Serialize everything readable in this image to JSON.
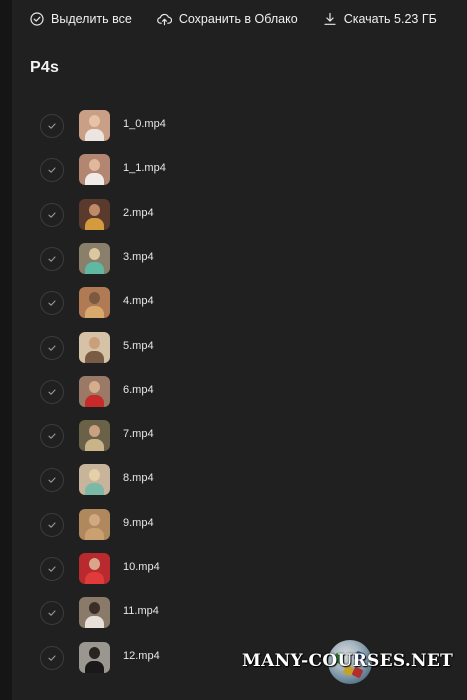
{
  "toolbar": {
    "select_all_label": "Выделить все",
    "save_cloud_label": "Сохранить в Облако",
    "download_label": "Скачать 5.23 ГБ"
  },
  "folder": {
    "title": "P4s"
  },
  "files": [
    {
      "name": "1_0.mp4",
      "thumb_bg": "#c9a086",
      "thumb_head": "#e6c2a6",
      "thumb_body": "#ece4df"
    },
    {
      "name": "1_1.mp4",
      "thumb_bg": "#b28670",
      "thumb_head": "#e1b89c",
      "thumb_body": "#f0ebe8"
    },
    {
      "name": "2.mp4",
      "thumb_bg": "#5a3a2c",
      "thumb_head": "#c08a68",
      "thumb_body": "#d39a3e"
    },
    {
      "name": "3.mp4",
      "thumb_bg": "#8a7f6a",
      "thumb_head": "#dcc7a0",
      "thumb_body": "#5fb8a2"
    },
    {
      "name": "4.mp4",
      "thumb_bg": "#b07a54",
      "thumb_head": "#7a5a40",
      "thumb_body": "#d9a86c"
    },
    {
      "name": "5.mp4",
      "thumb_bg": "#d6c2a6",
      "thumb_head": "#caa07a",
      "thumb_body": "#7a5c44"
    },
    {
      "name": "6.mp4",
      "thumb_bg": "#9a7a66",
      "thumb_head": "#d6ad8c",
      "thumb_body": "#c82a2a"
    },
    {
      "name": "7.mp4",
      "thumb_bg": "#6a6248",
      "thumb_head": "#c9a080",
      "thumb_body": "#c9b48a"
    },
    {
      "name": "8.mp4",
      "thumb_bg": "#c8b49a",
      "thumb_head": "#e6d0a8",
      "thumb_body": "#7ab8a8"
    },
    {
      "name": "9.mp4",
      "thumb_bg": "#b0885e",
      "thumb_head": "#d2a882",
      "thumb_body": "#caa070"
    },
    {
      "name": "10.mp4",
      "thumb_bg": "#b82a2e",
      "thumb_head": "#d8a68a",
      "thumb_body": "#e03a3a"
    },
    {
      "name": "11.mp4",
      "thumb_bg": "#8a7a6a",
      "thumb_head": "#3a2e26",
      "thumb_body": "#e6e0d8"
    },
    {
      "name": "12.mp4",
      "thumb_bg": "#9a9690",
      "thumb_head": "#2a2420",
      "thumb_body": "#1a1818"
    }
  ],
  "watermark": {
    "text": "MANY-COURSES.NET"
  }
}
